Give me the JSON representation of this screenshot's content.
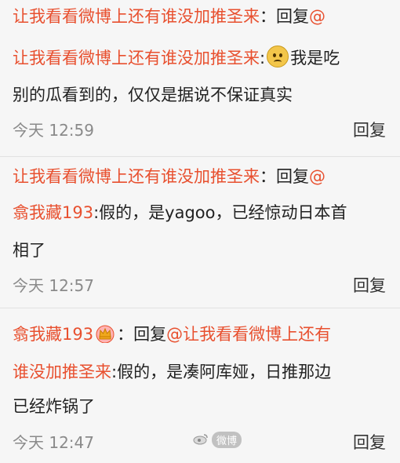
{
  "colors": {
    "link": "#e8502f",
    "time": "#8a8a8a",
    "background": "#f6f6f6"
  },
  "comments": [
    {
      "lines": [
        {
          "user": "让我看看微博上还有谁没加推圣来",
          "text": "：回复",
          "mention": "@"
        },
        {
          "mention": "让我看看微博上还有谁没加推圣来",
          "text": ":",
          "emoji": "pensive-face-icon",
          "text2": "我是吃"
        },
        {
          "text": "别的瓜看到的，仅仅是据说不保证真实"
        }
      ],
      "time": "今天 12:59",
      "reply": "回复"
    },
    {
      "lines": [
        {
          "user": "让我看看微博上还有谁没加推圣来",
          "text": "：回复",
          "mention": "@"
        },
        {
          "mention": "翕我藏193",
          "text": ":假的，是yagoo，已经惊动日本首"
        },
        {
          "text": "相了"
        }
      ],
      "time": "今天 12:57",
      "reply": "回复"
    },
    {
      "lines": [
        {
          "user": "翕我藏193",
          "badge": "crown-icon",
          "text": "：回复",
          "mention": "@让我看看微博上还有"
        },
        {
          "mention": "谁没加推圣来",
          "text": ":假的，是凑阿库娅，日推那边"
        },
        {
          "text": "已经炸锅了"
        }
      ],
      "time": "今天 12:47",
      "reply": "回复"
    }
  ],
  "watermark": {
    "text": "微博"
  }
}
